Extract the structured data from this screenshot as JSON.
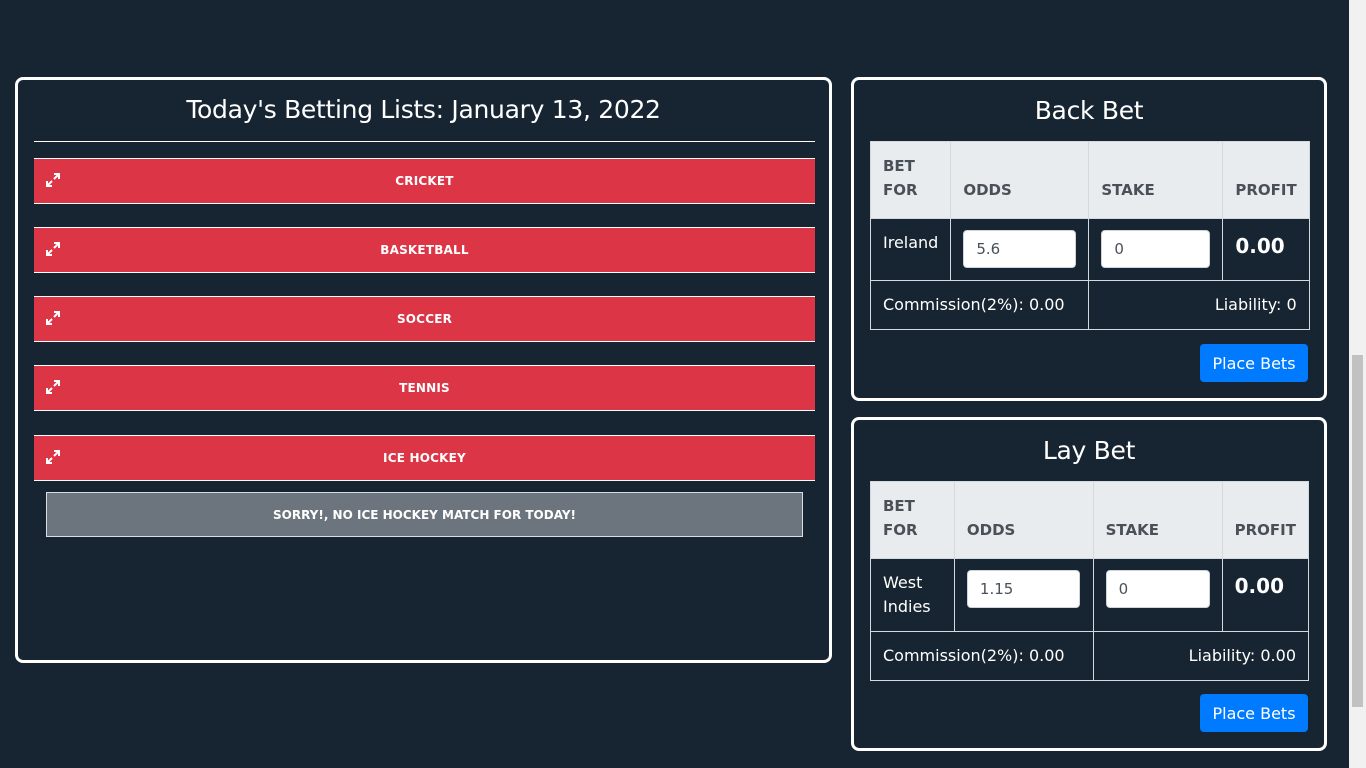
{
  "betting_list": {
    "title": "Today's Betting Lists: January 13, 2022",
    "sports": [
      {
        "label": "CRICKET",
        "icon": "expand-icon"
      },
      {
        "label": "BASKETBALL",
        "icon": "expand-icon"
      },
      {
        "label": "SOCCER",
        "icon": "expand-icon"
      },
      {
        "label": "TENNIS",
        "icon": "expand-icon"
      },
      {
        "label": "ICE HOCKEY",
        "icon": "expand-icon"
      }
    ],
    "empty_message": "SORRY!, NO ICE HOCKEY MATCH FOR TODAY!"
  },
  "back_bet": {
    "title": "Back Bet",
    "headers": {
      "bet_for": "BET FOR",
      "odds": "ODDS",
      "stake": "STAKE",
      "profit": "PROFIT"
    },
    "team": "Ireland",
    "odds": "5.6",
    "stake": "0",
    "profit": "0.00",
    "commission": "Commission(2%): 0.00",
    "liability": "Liability: 0",
    "button": "Place Bets"
  },
  "lay_bet": {
    "title": "Lay Bet",
    "headers": {
      "bet_for": "BET FOR",
      "odds": "ODDS",
      "stake": "STAKE",
      "profit": "PROFIT"
    },
    "team": "West Indies",
    "odds": "1.15",
    "stake": "0",
    "profit": "0.00",
    "commission": "Commission(2%): 0.00",
    "liability": "Liability: 0.00",
    "button": "Place Bets"
  },
  "colors": {
    "background": "#172532",
    "sport_bar": "#dc3545",
    "empty_box": "#6c757d",
    "table_header": "#e9ecef",
    "primary_button": "#007bff"
  }
}
